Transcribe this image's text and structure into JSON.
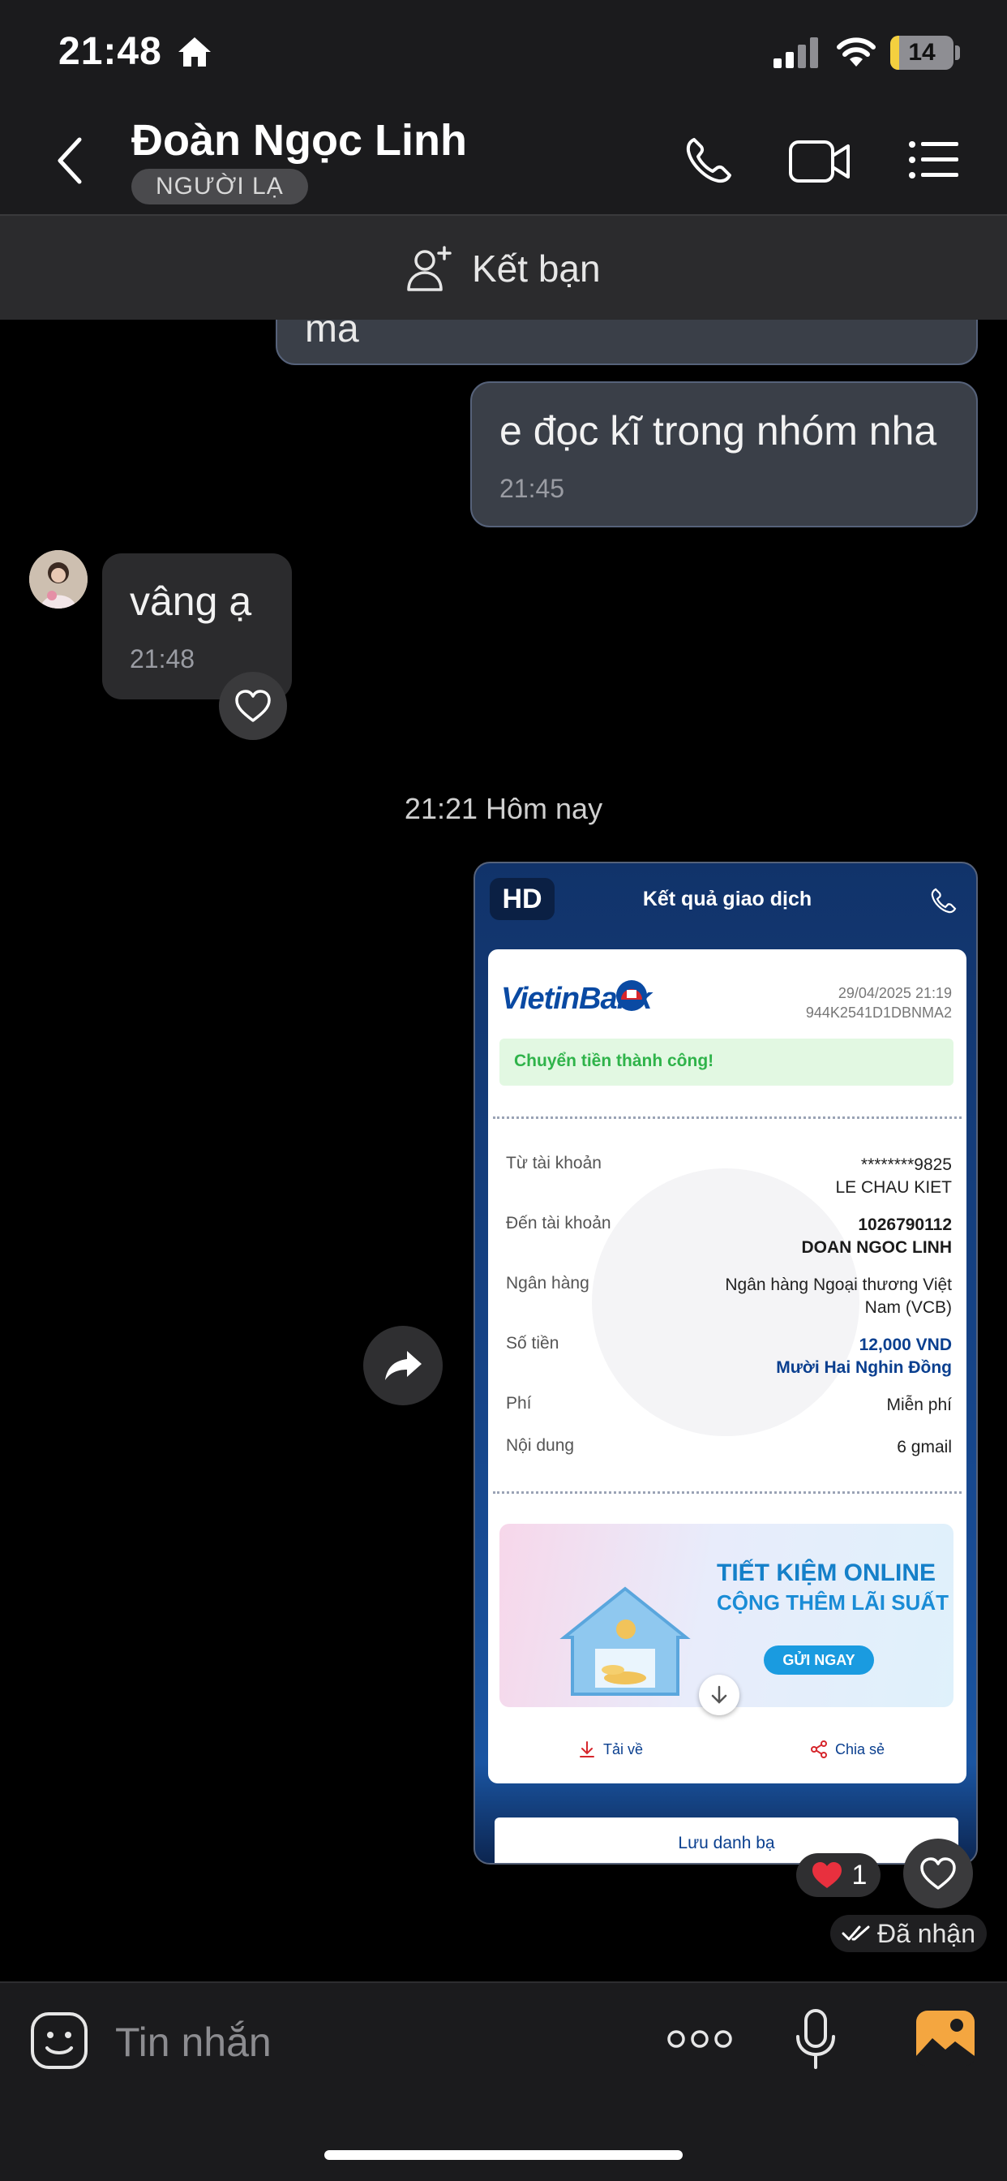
{
  "status_bar": {
    "time": "21:48",
    "battery": "14",
    "battery_level": 0.14
  },
  "header": {
    "contact_name": "Đoàn Ngọc Linh",
    "badge": "NGƯỜI LẠ"
  },
  "friend_bar": {
    "label": "Kết bạn"
  },
  "messages": [
    {
      "text": "mà",
      "time": ""
    },
    {
      "text": "e đọc kĩ trong nhóm nha",
      "time": "21:45"
    },
    {
      "text": "vâng ạ",
      "time": "21:48"
    }
  ],
  "date_separator": "21:21 Hôm nay",
  "receipt": {
    "hd": "HD",
    "title": "Kết quả giao dịch",
    "bank_logo": "VietinBank",
    "date": "29/04/2025 21:19",
    "ref": "944K2541D1DBNMA2",
    "status": "Chuyển tiền thành công!",
    "rows": [
      {
        "label": "Từ tài khoản",
        "value": "********9825",
        "value2": "LE CHAU KIET"
      },
      {
        "label": "Đến tài khoản",
        "value": "1026790112",
        "value2": "DOAN NGOC LINH"
      },
      {
        "label": "Ngân hàng",
        "value": "Ngân hàng Ngoại thương Việt",
        "value2": "Nam (VCB)"
      },
      {
        "label": "Số tiền",
        "value": "12,000 VND",
        "value2": "Mười Hai Nghin Đồng"
      },
      {
        "label": "Phí",
        "value": "Miễn phí",
        "value2": ""
      },
      {
        "label": "Nội dung",
        "value": "6 gmail",
        "value2": ""
      }
    ],
    "ad": {
      "line1": "TIẾT KIỆM ONLINE",
      "line2": "CỘNG THÊM LÃI SUẤT",
      "button": "GỬI NGAY"
    },
    "download": "Tải về",
    "share": "Chia sẻ",
    "save_contact": "Lưu danh bạ"
  },
  "reaction_count": "1",
  "delivered": "Đã nhận",
  "input": {
    "placeholder": "Tin nhắn"
  },
  "colors": {
    "accent": "#f4a640",
    "bubble_out": "#3a3f48",
    "bubble_in": "#2b2b2d",
    "success": "#2fb34a"
  }
}
